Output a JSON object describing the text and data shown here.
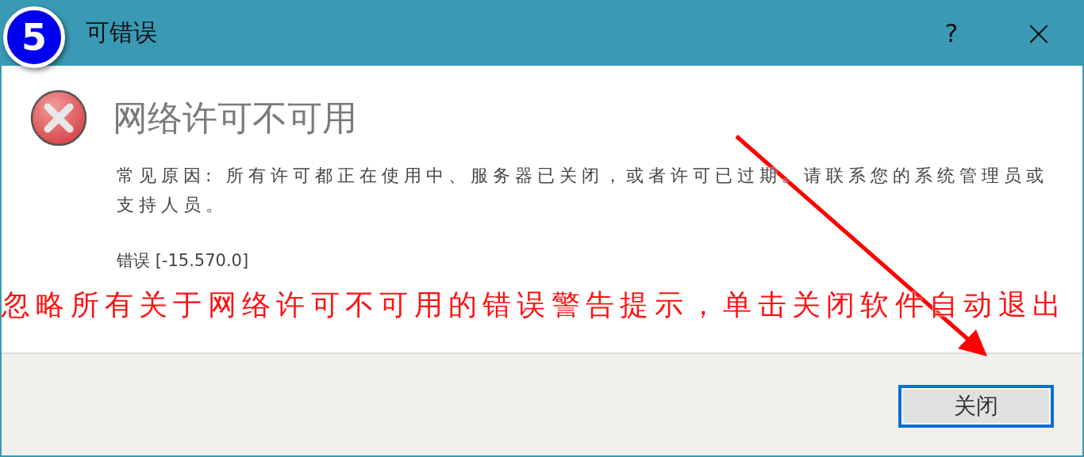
{
  "badge": "5",
  "window": {
    "title": "可错误",
    "help_button": "?",
    "close_button": "×"
  },
  "heading": "网络许可不可用",
  "message": "常见原因: 所有许可都正在使用中、服务器已关闭，或者许可已过期。请联系您的系统管理员或支持人员。",
  "error_code": "错误 [-15.570.0]",
  "annotation": "忽略所有关于网络许可不可用的错误警告提示，单击关闭软件自动退出",
  "buttons": [
    {
      "label": "关闭",
      "focused": true
    }
  ]
}
